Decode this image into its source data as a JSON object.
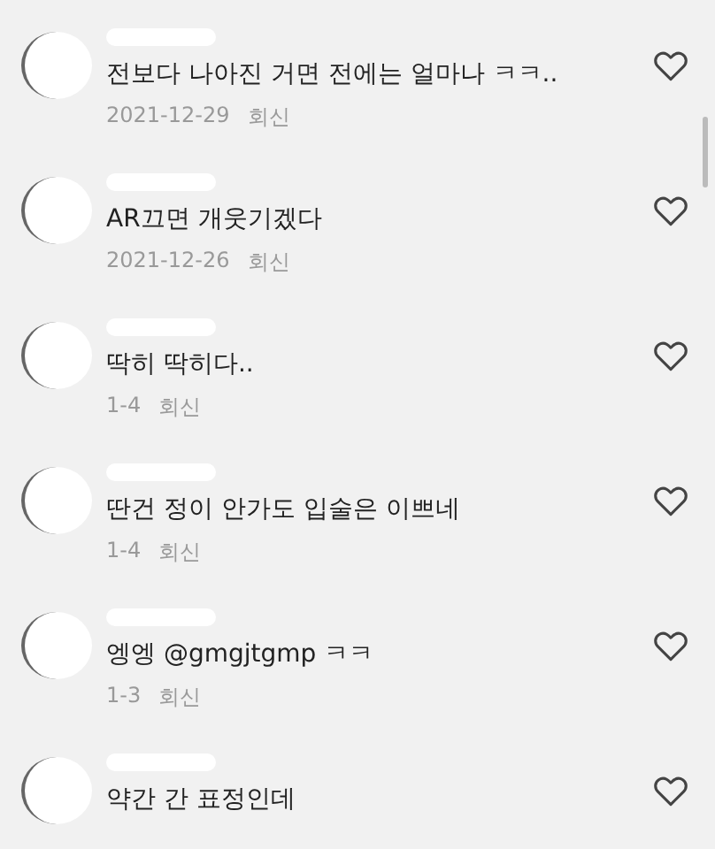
{
  "comments": [
    {
      "text": "전보다 나아진 거면 전에는 얼마나 ㅋㅋ..",
      "date": "2021-12-29",
      "reply": "회신"
    },
    {
      "text": "AR끄면 개웃기겠다",
      "date": "2021-12-26",
      "reply": "회신"
    },
    {
      "text": "딱히 딱히다..",
      "date": "1-4",
      "reply": "회신"
    },
    {
      "text": "딴건 정이 안가도 입술은 이쁘네",
      "date": "1-4",
      "reply": "회신"
    },
    {
      "text": "엥엥 @gmgjtgmp ㅋㅋ",
      "date": "1-3",
      "reply": "회신"
    },
    {
      "text": "약간 간 표정인데"
    }
  ]
}
